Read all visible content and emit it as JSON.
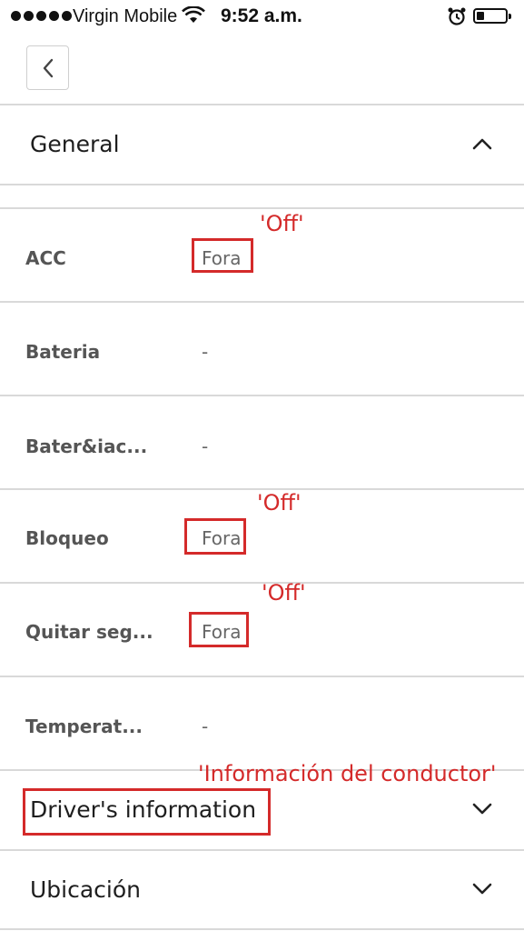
{
  "status_bar": {
    "carrier": "Virgin Mobile",
    "time": "9:52 a.m."
  },
  "sections": {
    "general": "General",
    "drivers_information": "Driver's information",
    "ubicacion": "Ubicación"
  },
  "rows": [
    {
      "label": "ACC",
      "value": "Fora"
    },
    {
      "label": "Bateria",
      "value": "-"
    },
    {
      "label": "Bater&iac...",
      "value": "-"
    },
    {
      "label": "Bloqueo",
      "value": "Fora"
    },
    {
      "label": "Quitar seg...",
      "value": "Fora"
    },
    {
      "label": "Temperat...",
      "value": "-"
    }
  ],
  "annotations": {
    "acc_off": "'Off'",
    "bloqueo_off": "'Off'",
    "quitar_off": "'Off'",
    "driver_translation": "'Información del conductor'"
  },
  "colors": {
    "annotation": "#d42a2a",
    "divider": "#d9d9d9"
  },
  "icons": {
    "back": "chevron-left-icon",
    "expanded": "chevron-up-icon",
    "collapsed": "chevron-down-icon"
  }
}
